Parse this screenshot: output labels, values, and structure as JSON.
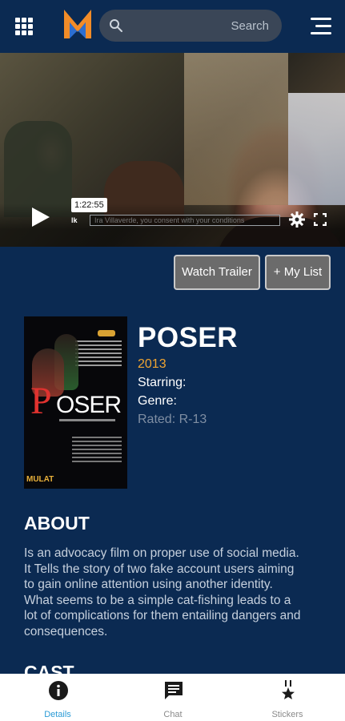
{
  "header": {
    "search": {
      "placeholder": "Search",
      "value": ""
    },
    "brand_colors": {
      "orange": "#f28c28",
      "blue": "#2d6fd1"
    }
  },
  "player": {
    "time": "1:22:55",
    "tick": "lk",
    "subtitle_track": "Ira Villaverde, you consent with your conditions"
  },
  "actions": {
    "watch_trailer": "Watch Trailer",
    "my_list": "+ My List"
  },
  "movie": {
    "title": "POSER",
    "year": "2013",
    "starring_label": "Starring:",
    "genre_label": "Genre:",
    "rated": "Rated: R-13",
    "poster": {
      "title_p": "P",
      "title_rest": "OSER",
      "studio": "MULAT"
    }
  },
  "about": {
    "heading": "ABOUT",
    "text": "Is an advocacy film on proper use of social media. It Tells the story of two fake account users aiming to gain online attention using another identity. What seems to be a simple cat-fishing leads to a lot of complications for them entailing dangers and consequences."
  },
  "cast": {
    "heading": "CAST"
  },
  "bottom_nav": {
    "items": [
      {
        "label": "Details",
        "icon": "info-icon",
        "active": true
      },
      {
        "label": "Chat",
        "icon": "chat-icon",
        "active": false
      },
      {
        "label": "Stickers",
        "icon": "medal-icon",
        "active": false
      }
    ],
    "active_color": "#2b9bd6"
  }
}
